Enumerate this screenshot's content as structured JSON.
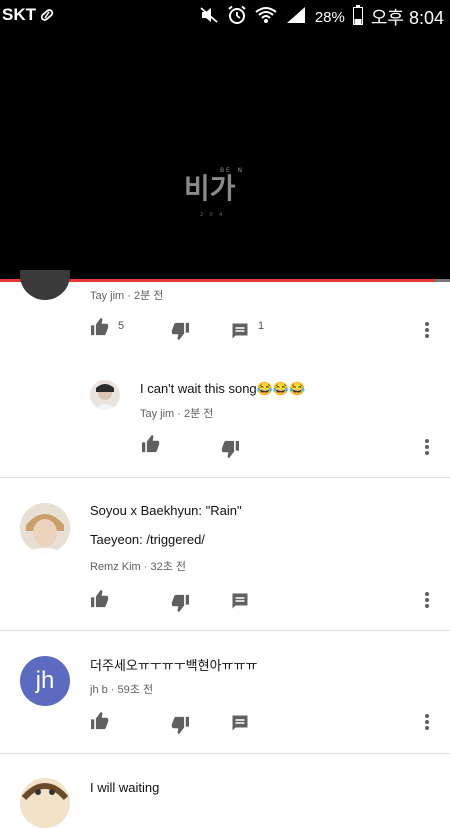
{
  "status_bar": {
    "carrier": "SKT",
    "battery": "28%",
    "time": "오후 8:04"
  },
  "comments": [
    {
      "author": "Tay jim",
      "time": "2분 전",
      "likes": "5",
      "replies": "1"
    },
    {
      "author": "Tay jim",
      "time": "2분 전",
      "text": "I can't wait this song😂😂😂",
      "is_reply": true
    },
    {
      "author": "Remz Kim",
      "time": "32초 전",
      "text_line1": "Soyou x Baekhyun: \"Rain\"",
      "text_line2": "Taeyeon: /triggered/"
    },
    {
      "author": "jh b",
      "time": "59초 전",
      "text": "더주세오ㅠㅜㅠㅜ백현아ㅠㅠㅠ",
      "avatar_initials": "jh"
    },
    {
      "text": "I will waiting"
    }
  ]
}
